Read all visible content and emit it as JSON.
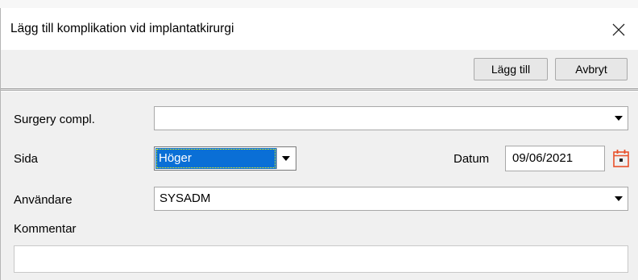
{
  "dialog": {
    "title": "Lägg till komplikation vid implantatkirurgi"
  },
  "toolbar": {
    "add_label": "Lägg till",
    "cancel_label": "Avbryt"
  },
  "form": {
    "surgery_compl": {
      "label": "Surgery compl.",
      "value": ""
    },
    "sida": {
      "label": "Sida",
      "value": "Höger"
    },
    "datum": {
      "label": "Datum",
      "value": "09/06/2021"
    },
    "anvandare": {
      "label": "Användare",
      "value": "SYSADM"
    },
    "kommentar": {
      "label": "Kommentar",
      "value": ""
    }
  },
  "colors": {
    "selection": "#0a6fd6",
    "calendar_icon": "#e8502a",
    "toolbar_separator": "#8c8c8c"
  },
  "icons": [
    "close-icon",
    "dropdown-arrow-icon",
    "calendar-icon"
  ]
}
